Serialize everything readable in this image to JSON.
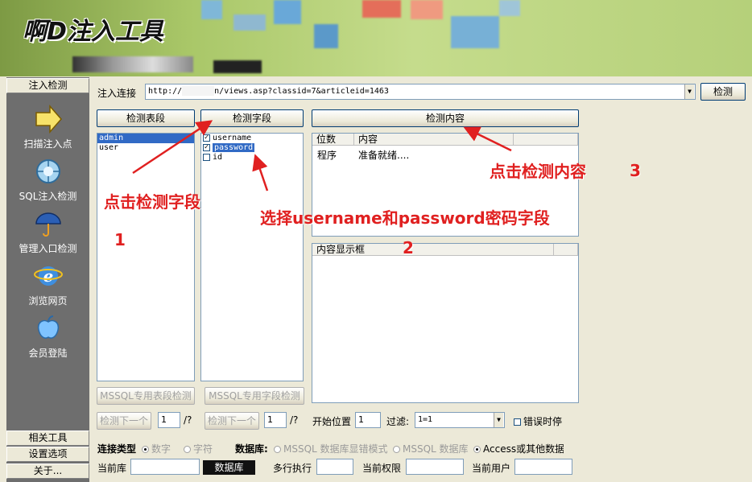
{
  "app_title": "啊D注入工具",
  "sidebar": {
    "header": "注入检测",
    "items": [
      {
        "label": "扫描注入点",
        "icon": "arrow-right-icon"
      },
      {
        "label": "SQL注入检测",
        "icon": "globe-icon"
      },
      {
        "label": "管理入口检测",
        "icon": "umbrella-icon"
      },
      {
        "label": "浏览网页",
        "icon": "ie-browser-icon"
      },
      {
        "label": "会员登陆",
        "icon": "apple-icon"
      }
    ],
    "bottom": [
      "相关工具",
      "设置选项",
      "关于..."
    ]
  },
  "url_bar": {
    "label": "注入连接",
    "prefix": "http://",
    "value": "n/views.asp?classid=7&articleid=1463",
    "detect_button": "检测"
  },
  "panels": {
    "tables_button": "检测表段",
    "fields_button": "检测字段",
    "content_button": "检测内容",
    "tables": [
      {
        "name": "admin",
        "selected": true
      },
      {
        "name": "user",
        "selected": false
      }
    ],
    "fields": [
      {
        "name": "username",
        "checked": true,
        "selected": false
      },
      {
        "name": "password",
        "checked": true,
        "selected": true
      },
      {
        "name": "id",
        "checked": false,
        "selected": false
      }
    ],
    "content_columns": [
      "位数",
      "内容"
    ],
    "content_rows": [
      [
        "程序",
        "准备就绪...."
      ]
    ],
    "display_header": "内容显示框",
    "mssql_table_button": "MSSQL专用表段检测",
    "mssql_field_button": "MSSQL专用字段检测"
  },
  "controls": {
    "next1": "检测下一个",
    "next1_value": "1",
    "next1_total": "/?",
    "next2": "检测下一个",
    "next2_value": "1",
    "next2_total": "/?",
    "start_label": "开始位置",
    "start_value": "1",
    "filter_label": "过滤:",
    "filter_value": "1=1",
    "error_label": "错误时停"
  },
  "connection": {
    "type_label": "连接类型",
    "type_options": [
      "数字",
      "字符"
    ],
    "db_label": "数据库:",
    "db_options": [
      "MSSQL 数据库显错模式",
      "MSSQL 数据库",
      "Access或其他数据"
    ],
    "db_selected_index": 2
  },
  "status": {
    "current_db": "当前库",
    "db_button": "数据库",
    "multi_exec": "多行执行",
    "current_perm": "当前权限",
    "current_user": "当前用户"
  },
  "annotations": {
    "a1": "点击检测字段",
    "a1_num": "1",
    "a2": "选择username和password密码字段",
    "a2_num": "2",
    "a3": "点击检测内容",
    "a3_num": "3"
  },
  "colors": {
    "selection": "#316ac5",
    "annotation": "#e02020",
    "sidebar": "#6e6e6e",
    "banner": "#a9c768"
  }
}
